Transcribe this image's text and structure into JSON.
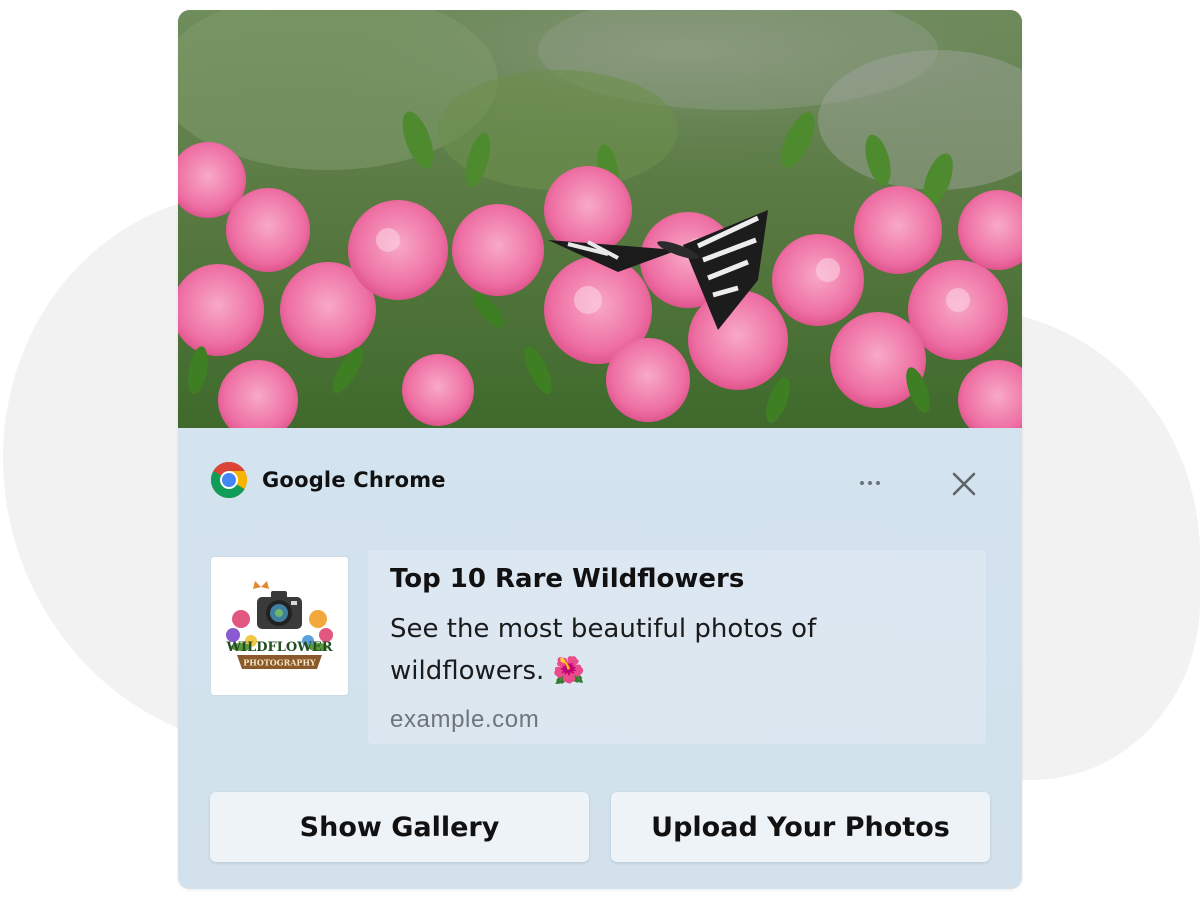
{
  "notification": {
    "app_name": "Google Chrome",
    "app_icon": "chrome-icon",
    "more_icon": "more-horizontal-icon",
    "close_icon": "close-icon",
    "hero_image": "photo of pink azalea flowers with a swallowtail butterfly",
    "thumbnail_logo": {
      "line1": "WILDFLOWER",
      "line2": "PHOTOGRAPHY"
    },
    "title": "Top 10 Rare Wildflowers",
    "body": "See the most beautiful photos of wildflowers. 🌺",
    "origin": "example.com",
    "actions": [
      {
        "label": "Show Gallery"
      },
      {
        "label": "Upload Your Photos"
      }
    ]
  },
  "colors": {
    "panel_background": "#d3e3ef",
    "button_background": "#eef3f7",
    "page_background": "#ffffff",
    "blob": "#f2f2f2"
  }
}
